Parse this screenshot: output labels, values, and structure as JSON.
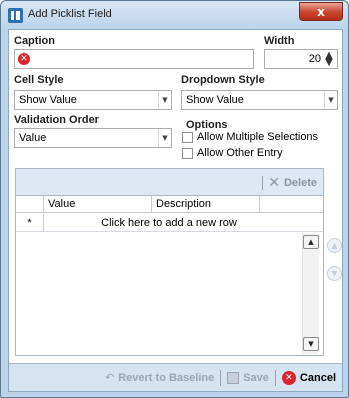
{
  "window": {
    "title": "Add Picklist Field",
    "close_symbol": "x"
  },
  "form": {
    "caption": {
      "label": "Caption",
      "value": ""
    },
    "width": {
      "label": "Width",
      "value": "20"
    },
    "cell_style": {
      "label": "Cell Style",
      "value": "Show Value"
    },
    "dropdown_style": {
      "label": "Dropdown Style",
      "value": "Show Value"
    },
    "validation_order": {
      "label": "Validation Order",
      "value": "Value"
    },
    "options": {
      "label": "Options",
      "allow_multiple": {
        "label": "Allow Multiple Selections",
        "checked": false
      },
      "allow_other": {
        "label": "Allow Other Entry",
        "checked": false
      }
    }
  },
  "values_panel": {
    "delete_label": "Delete",
    "columns": [
      "Value",
      "Description"
    ],
    "new_row_indicator": "*",
    "new_row_text": "Click here to add a new row"
  },
  "footer": {
    "revert_label": "Revert to Baseline",
    "save_label": "Save",
    "cancel_label": "Cancel"
  },
  "icons": {
    "app": "picklist-icon",
    "caption_error": "error-icon",
    "delete": "x-icon",
    "revert": "revert-arrow-icon",
    "save": "floppy-disk-icon",
    "cancel": "cancel-icon"
  },
  "colors": {
    "error": "#d9262c",
    "title_bar": "#bcd3ea",
    "close_button": "#c9432f"
  }
}
